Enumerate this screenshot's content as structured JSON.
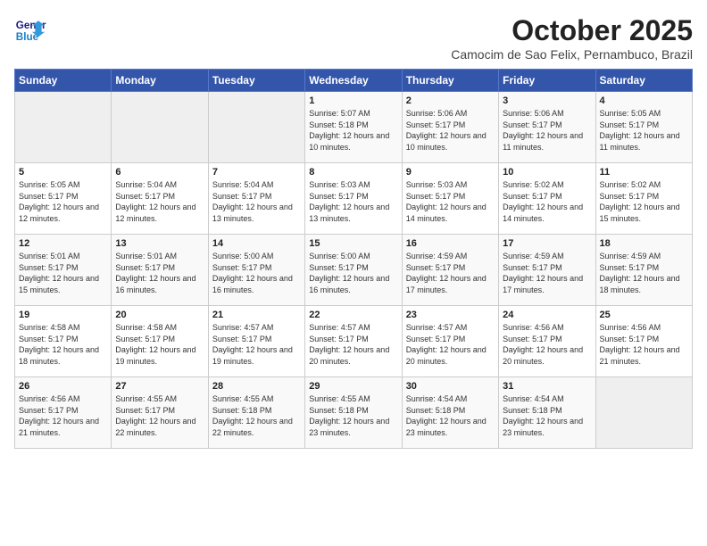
{
  "header": {
    "logo_line1": "General",
    "logo_line2": "Blue",
    "month": "October 2025",
    "location": "Camocim de Sao Felix, Pernambuco, Brazil"
  },
  "days_of_week": [
    "Sunday",
    "Monday",
    "Tuesday",
    "Wednesday",
    "Thursday",
    "Friday",
    "Saturday"
  ],
  "weeks": [
    [
      {
        "day": "",
        "info": ""
      },
      {
        "day": "",
        "info": ""
      },
      {
        "day": "",
        "info": ""
      },
      {
        "day": "1",
        "info": "Sunrise: 5:07 AM\nSunset: 5:18 PM\nDaylight: 12 hours and 10 minutes."
      },
      {
        "day": "2",
        "info": "Sunrise: 5:06 AM\nSunset: 5:17 PM\nDaylight: 12 hours and 10 minutes."
      },
      {
        "day": "3",
        "info": "Sunrise: 5:06 AM\nSunset: 5:17 PM\nDaylight: 12 hours and 11 minutes."
      },
      {
        "day": "4",
        "info": "Sunrise: 5:05 AM\nSunset: 5:17 PM\nDaylight: 12 hours and 11 minutes."
      }
    ],
    [
      {
        "day": "5",
        "info": "Sunrise: 5:05 AM\nSunset: 5:17 PM\nDaylight: 12 hours and 12 minutes."
      },
      {
        "day": "6",
        "info": "Sunrise: 5:04 AM\nSunset: 5:17 PM\nDaylight: 12 hours and 12 minutes."
      },
      {
        "day": "7",
        "info": "Sunrise: 5:04 AM\nSunset: 5:17 PM\nDaylight: 12 hours and 13 minutes."
      },
      {
        "day": "8",
        "info": "Sunrise: 5:03 AM\nSunset: 5:17 PM\nDaylight: 12 hours and 13 minutes."
      },
      {
        "day": "9",
        "info": "Sunrise: 5:03 AM\nSunset: 5:17 PM\nDaylight: 12 hours and 14 minutes."
      },
      {
        "day": "10",
        "info": "Sunrise: 5:02 AM\nSunset: 5:17 PM\nDaylight: 12 hours and 14 minutes."
      },
      {
        "day": "11",
        "info": "Sunrise: 5:02 AM\nSunset: 5:17 PM\nDaylight: 12 hours and 15 minutes."
      }
    ],
    [
      {
        "day": "12",
        "info": "Sunrise: 5:01 AM\nSunset: 5:17 PM\nDaylight: 12 hours and 15 minutes."
      },
      {
        "day": "13",
        "info": "Sunrise: 5:01 AM\nSunset: 5:17 PM\nDaylight: 12 hours and 16 minutes."
      },
      {
        "day": "14",
        "info": "Sunrise: 5:00 AM\nSunset: 5:17 PM\nDaylight: 12 hours and 16 minutes."
      },
      {
        "day": "15",
        "info": "Sunrise: 5:00 AM\nSunset: 5:17 PM\nDaylight: 12 hours and 16 minutes."
      },
      {
        "day": "16",
        "info": "Sunrise: 4:59 AM\nSunset: 5:17 PM\nDaylight: 12 hours and 17 minutes."
      },
      {
        "day": "17",
        "info": "Sunrise: 4:59 AM\nSunset: 5:17 PM\nDaylight: 12 hours and 17 minutes."
      },
      {
        "day": "18",
        "info": "Sunrise: 4:59 AM\nSunset: 5:17 PM\nDaylight: 12 hours and 18 minutes."
      }
    ],
    [
      {
        "day": "19",
        "info": "Sunrise: 4:58 AM\nSunset: 5:17 PM\nDaylight: 12 hours and 18 minutes."
      },
      {
        "day": "20",
        "info": "Sunrise: 4:58 AM\nSunset: 5:17 PM\nDaylight: 12 hours and 19 minutes."
      },
      {
        "day": "21",
        "info": "Sunrise: 4:57 AM\nSunset: 5:17 PM\nDaylight: 12 hours and 19 minutes."
      },
      {
        "day": "22",
        "info": "Sunrise: 4:57 AM\nSunset: 5:17 PM\nDaylight: 12 hours and 20 minutes."
      },
      {
        "day": "23",
        "info": "Sunrise: 4:57 AM\nSunset: 5:17 PM\nDaylight: 12 hours and 20 minutes."
      },
      {
        "day": "24",
        "info": "Sunrise: 4:56 AM\nSunset: 5:17 PM\nDaylight: 12 hours and 20 minutes."
      },
      {
        "day": "25",
        "info": "Sunrise: 4:56 AM\nSunset: 5:17 PM\nDaylight: 12 hours and 21 minutes."
      }
    ],
    [
      {
        "day": "26",
        "info": "Sunrise: 4:56 AM\nSunset: 5:17 PM\nDaylight: 12 hours and 21 minutes."
      },
      {
        "day": "27",
        "info": "Sunrise: 4:55 AM\nSunset: 5:17 PM\nDaylight: 12 hours and 22 minutes."
      },
      {
        "day": "28",
        "info": "Sunrise: 4:55 AM\nSunset: 5:18 PM\nDaylight: 12 hours and 22 minutes."
      },
      {
        "day": "29",
        "info": "Sunrise: 4:55 AM\nSunset: 5:18 PM\nDaylight: 12 hours and 23 minutes."
      },
      {
        "day": "30",
        "info": "Sunrise: 4:54 AM\nSunset: 5:18 PM\nDaylight: 12 hours and 23 minutes."
      },
      {
        "day": "31",
        "info": "Sunrise: 4:54 AM\nSunset: 5:18 PM\nDaylight: 12 hours and 23 minutes."
      },
      {
        "day": "",
        "info": ""
      }
    ]
  ]
}
